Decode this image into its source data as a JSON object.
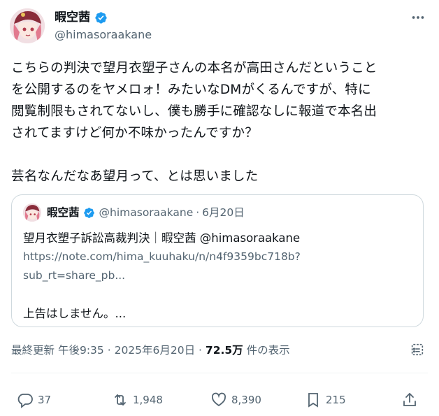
{
  "author": {
    "display_name": "暇空茜",
    "handle": "@himasoraakane"
  },
  "tweet": {
    "lines": [
      "こちらの判決で望月衣塑子さんの本名が高田さんだということ",
      "を公開するのをヤメロォ！みたいなDMがくるんですが、特に",
      "閲覧制限もされてないし、僕も勝手に確認なしに報道で本名出",
      "されてますけど何か不味かったんですか？",
      "芸名なんだなあ望月って、とは思いました"
    ]
  },
  "quote": {
    "display_name": "暇空茜",
    "handle": "@himasoraakane",
    "separator": "·",
    "date": "6月20日",
    "title": "望月衣塑子訴訟高裁判決｜暇空茜 @himasoraakane",
    "link_line1": "https://note.com/hima_kuuhaku/n/n4f9359bc718b?",
    "link_line2": "sub_rt=share_pb...",
    "excerpt": "上告はしません。..."
  },
  "meta": {
    "updated_label": "最終更新",
    "time": "午後9:35",
    "sep1": "·",
    "date": "2025年6月20日",
    "sep2": "·",
    "views": "72.5万",
    "views_label": "件の表示"
  },
  "actions": {
    "reply_count": "37",
    "retweet_count": "1,948",
    "like_count": "8,390",
    "bookmark_count": "215"
  },
  "icons": {
    "verified": "verified-badge-icon",
    "more": "more-icon",
    "analytics": "analytics-icon",
    "reply": "reply-icon",
    "retweet": "retweet-icon",
    "like": "heart-icon",
    "bookmark": "bookmark-icon",
    "share": "share-icon"
  },
  "colors": {
    "verified_blue": "#1d9bf0",
    "text": "#0f1419",
    "secondary": "#536471"
  }
}
